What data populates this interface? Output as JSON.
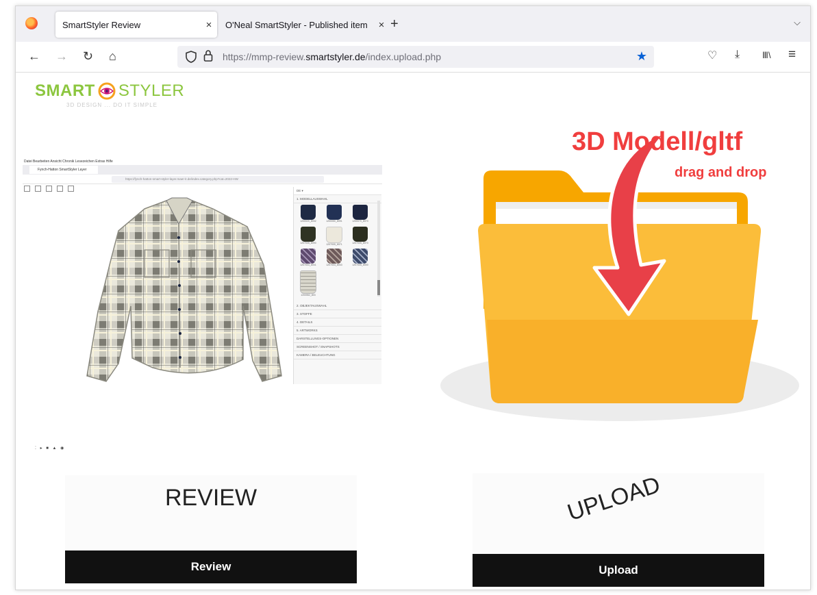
{
  "browser": {
    "tabs": [
      {
        "title": "SmartStyler Review",
        "close": "×",
        "active": true
      },
      {
        "title": "O'Neal SmartStyler - Published item",
        "close": "×",
        "active": false
      }
    ],
    "new_tab": "+",
    "tab_menu": "⌵",
    "nav": {
      "back": "←",
      "forward": "→",
      "reload": "↻",
      "home": "⌂"
    },
    "url": {
      "prefix": "https://mmp-review.",
      "domain": "smartstyler.de",
      "suffix": "/index.upload.php"
    },
    "bookmark_star": "★",
    "right_icons": {
      "pocket": "♡",
      "downloads": "⤓",
      "library": "Ⅲ\\",
      "menu": "≡"
    }
  },
  "page": {
    "logo": {
      "smart": "SMART",
      "styler": "STYLER",
      "tagline": "3D DESIGN ... DO IT SIMPLE"
    },
    "preview": {
      "menu_text": "Datei  Bearbeiten  Ansicht  Chronik  Lesezeichen  Extras  Hilfe",
      "tab_title": "Fynch-Hatton SmartStyler Layer",
      "url_text": "https://fynch-hatton-smart-styler-layer.maer-it.de/index.category.php?cat=2022-HW",
      "lang": "DE ▾",
      "panel_items": [
        "1. MODELLAUSWAHL",
        "2. OBJEKTAUSWAHL",
        "3. STOFFE",
        "4. DETAILS",
        "5. ARTWORKS",
        "DARSTELLUNGS-OPTIONEN",
        "SCREENSHOT / SNAPSHOTS",
        "KAMERA / BELEUCHTUNG"
      ],
      "thumb_captions": [
        "1200020_8032",
        "1200050_8091",
        "1200070_8070",
        "1207005_8090",
        "1207005_8071",
        "1207005_8070",
        "1207004_8041",
        "1207004_8043",
        "1207005_8000",
        "1200552_803"
      ],
      "thumb_colors": [
        "#1e2a44",
        "#223155",
        "#1c2540",
        "#2f3323",
        "#ece8dc",
        "#2b2e1f",
        "#5e4a6e",
        "#6e5a5a",
        "#3d4a6a",
        "#d9d7cc"
      ],
      "bottom_icons": "⁚ ▸ ■ ▲ ◉"
    },
    "upload_heading": "3D Modell/gltf",
    "upload_sub": "drag and drop",
    "cards": {
      "review": {
        "title": "REVIEW",
        "button": "Review"
      },
      "upload": {
        "title": "UPLOAD",
        "button": "Upload"
      }
    }
  },
  "colors": {
    "brand_green": "#8cc63f",
    "arrow_red": "#f03e3e",
    "folder_yellow": "#fbbd3a",
    "button_black": "#111111",
    "bookmark_blue": "#0a62d6"
  }
}
